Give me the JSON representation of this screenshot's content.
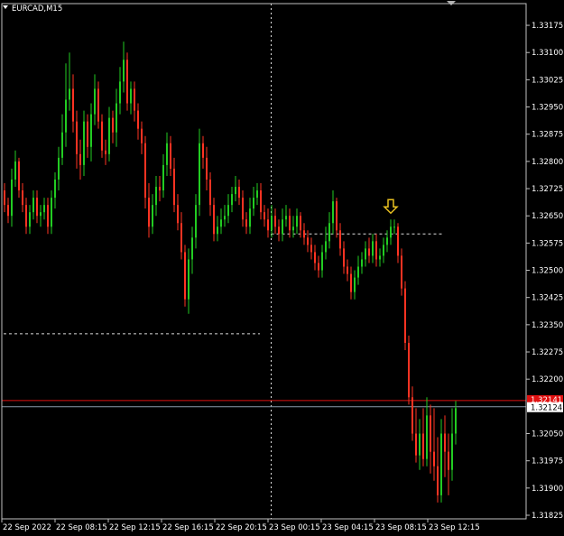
{
  "window": {
    "symbol_label": "EURCAD,M15"
  },
  "colors": {
    "background": "#000000",
    "frame": "#c0c0c0",
    "bull": "#22cc22",
    "bear": "#ff3322",
    "red_line": "#e01010",
    "ask_line": "#8a9aaa",
    "arrow": "#e8c020",
    "dashed": "#dddddd"
  },
  "markers": {
    "arrow_icon": "down-arrow-icon"
  },
  "chart_data": {
    "type": "candlestick",
    "symbol": "EURCAD",
    "timeframe": "M15",
    "ylim": [
      1.31825,
      1.332
    ],
    "y_ticks": [
      "1.33175",
      "1.33100",
      "1.33025",
      "1.32950",
      "1.32875",
      "1.32800",
      "1.32725",
      "1.32650",
      "1.32575",
      "1.32500",
      "1.32425",
      "1.32350",
      "1.32275",
      "1.32200",
      "1.32050",
      "1.31975",
      "1.31900",
      "1.31825"
    ],
    "x_ticks": [
      "22 Sep 2022",
      "22 Sep 08:15",
      "22 Sep 12:15",
      "22 Sep 16:15",
      "22 Sep 20:15",
      "23 Sep 00:15",
      "23 Sep 04:15",
      "23 Sep 08:15",
      "23 Sep 12:15"
    ],
    "price_labels": {
      "red": "1.32141",
      "current": "1.32124"
    },
    "levels": {
      "red_line": 1.32141,
      "current": 1.32124
    },
    "dashed_levels": [
      1.326,
      1.32325
    ],
    "crosshair_time_index": 74,
    "arrow_index": 107,
    "grid": false,
    "candles": {
      "o": [
        1.3272,
        1.3268,
        1.3265,
        1.3275,
        1.328,
        1.3272,
        1.3268,
        1.3262,
        1.3266,
        1.327,
        1.3265,
        1.3266,
        1.3268,
        1.3262,
        1.327,
        1.3275,
        1.3281,
        1.3288,
        1.3297,
        1.33,
        1.3291,
        1.3282,
        1.3279,
        1.3291,
        1.3284,
        1.3293,
        1.33,
        1.3291,
        1.3283,
        1.3282,
        1.3292,
        1.3288,
        1.3296,
        1.3302,
        1.3308,
        1.3296,
        1.33,
        1.3294,
        1.3289,
        1.3285,
        1.327,
        1.3262,
        1.3268,
        1.3273,
        1.3272,
        1.3279,
        1.3285,
        1.3278,
        1.3268,
        1.3263,
        1.3255,
        1.3242,
        1.3253,
        1.3259,
        1.3268,
        1.3285,
        1.3281,
        1.3275,
        1.3268,
        1.326,
        1.3262,
        1.3264,
        1.3265,
        1.3268,
        1.3271,
        1.3273,
        1.327,
        1.3264,
        1.3262,
        1.3267,
        1.327,
        1.3272,
        1.3266,
        1.3264,
        1.3261,
        1.3265,
        1.3262,
        1.326,
        1.3264,
        1.3265,
        1.3261,
        1.3262,
        1.3265,
        1.3261,
        1.3259,
        1.3257,
        1.3255,
        1.3252,
        1.325,
        1.3255,
        1.3258,
        1.3263,
        1.3269,
        1.3261,
        1.3256,
        1.3251,
        1.3249,
        1.3244,
        1.3248,
        1.3251,
        1.3253,
        1.3256,
        1.3254,
        1.3258,
        1.3253,
        1.3254,
        1.3257,
        1.3259,
        1.3262,
        1.3262,
        1.3254,
        1.3245,
        1.323,
        1.3215,
        1.3205,
        1.3199,
        1.3205,
        1.3198,
        1.321,
        1.32,
        1.3196,
        1.3188,
        1.3205,
        1.32,
        1.3195,
        1.3205
      ],
      "c": [
        1.3268,
        1.3265,
        1.3275,
        1.328,
        1.3272,
        1.3268,
        1.3262,
        1.3266,
        1.327,
        1.3265,
        1.3266,
        1.3268,
        1.3262,
        1.327,
        1.3275,
        1.3281,
        1.3288,
        1.3297,
        1.33,
        1.3291,
        1.3282,
        1.3279,
        1.3291,
        1.3284,
        1.3293,
        1.33,
        1.3291,
        1.3283,
        1.3282,
        1.3292,
        1.3288,
        1.3296,
        1.3302,
        1.3308,
        1.3296,
        1.33,
        1.3294,
        1.3289,
        1.3285,
        1.327,
        1.3262,
        1.3268,
        1.3273,
        1.3272,
        1.3279,
        1.3285,
        1.3278,
        1.3268,
        1.3263,
        1.3255,
        1.3242,
        1.3253,
        1.3259,
        1.3268,
        1.3285,
        1.3281,
        1.3275,
        1.3268,
        1.326,
        1.3262,
        1.3264,
        1.3265,
        1.3268,
        1.3271,
        1.3273,
        1.327,
        1.3264,
        1.3262,
        1.3267,
        1.327,
        1.3272,
        1.3266,
        1.3264,
        1.3261,
        1.3265,
        1.3262,
        1.326,
        1.3264,
        1.3265,
        1.3261,
        1.3262,
        1.3265,
        1.3261,
        1.3259,
        1.3257,
        1.3255,
        1.3252,
        1.325,
        1.3255,
        1.3258,
        1.3263,
        1.3269,
        1.3261,
        1.3256,
        1.3251,
        1.3249,
        1.3244,
        1.3248,
        1.3251,
        1.3253,
        1.3256,
        1.3254,
        1.3258,
        1.3253,
        1.3254,
        1.3257,
        1.3259,
        1.3262,
        1.3262,
        1.3254,
        1.3245,
        1.323,
        1.3215,
        1.3205,
        1.3199,
        1.3205,
        1.3198,
        1.321,
        1.32,
        1.3196,
        1.3188,
        1.3205,
        1.32,
        1.3195,
        1.3205,
        1.3212
      ],
      "h": [
        1.3274,
        1.327,
        1.3278,
        1.3283,
        1.3281,
        1.3274,
        1.327,
        1.3268,
        1.3272,
        1.3272,
        1.3268,
        1.327,
        1.327,
        1.3272,
        1.3277,
        1.3284,
        1.3293,
        1.3307,
        1.331,
        1.3304,
        1.3294,
        1.3286,
        1.3294,
        1.3293,
        1.3296,
        1.3304,
        1.3302,
        1.3293,
        1.3286,
        1.3295,
        1.3294,
        1.33,
        1.3306,
        1.3313,
        1.331,
        1.3302,
        1.3302,
        1.3296,
        1.3291,
        1.3287,
        1.3274,
        1.3271,
        1.3276,
        1.3276,
        1.3282,
        1.3288,
        1.3287,
        1.3281,
        1.3271,
        1.3266,
        1.3257,
        1.3256,
        1.3262,
        1.3271,
        1.3289,
        1.3287,
        1.3284,
        1.3277,
        1.327,
        1.3265,
        1.3267,
        1.3268,
        1.3271,
        1.3273,
        1.3276,
        1.3275,
        1.3272,
        1.3266,
        1.327,
        1.3273,
        1.3274,
        1.3274,
        1.3268,
        1.3267,
        1.3268,
        1.3267,
        1.3264,
        1.3267,
        1.3268,
        1.3267,
        1.3265,
        1.3267,
        1.3266,
        1.3263,
        1.3261,
        1.3259,
        1.3257,
        1.3254,
        1.3257,
        1.3262,
        1.3266,
        1.3272,
        1.327,
        1.3263,
        1.3258,
        1.3253,
        1.3251,
        1.325,
        1.3254,
        1.3255,
        1.3258,
        1.3259,
        1.326,
        1.326,
        1.3256,
        1.3259,
        1.3261,
        1.3264,
        1.3264,
        1.3263,
        1.3256,
        1.3247,
        1.3232,
        1.3218,
        1.3212,
        1.3209,
        1.3212,
        1.3215,
        1.3213,
        1.3212,
        1.3204,
        1.3209,
        1.321,
        1.3205,
        1.3212,
        1.3214
      ],
      "l": [
        1.3266,
        1.3263,
        1.3262,
        1.3273,
        1.327,
        1.3266,
        1.326,
        1.326,
        1.3264,
        1.3263,
        1.3262,
        1.3264,
        1.326,
        1.326,
        1.3267,
        1.3272,
        1.3279,
        1.3284,
        1.3294,
        1.3288,
        1.3278,
        1.3275,
        1.3276,
        1.3281,
        1.328,
        1.329,
        1.3289,
        1.3281,
        1.3279,
        1.328,
        1.3285,
        1.3284,
        1.3293,
        1.3299,
        1.3294,
        1.3293,
        1.3291,
        1.3286,
        1.3282,
        1.3267,
        1.3259,
        1.326,
        1.3265,
        1.3269,
        1.327,
        1.3276,
        1.3276,
        1.3266,
        1.3261,
        1.3253,
        1.324,
        1.3238,
        1.3249,
        1.3256,
        1.3265,
        1.3278,
        1.3272,
        1.3265,
        1.3258,
        1.3258,
        1.326,
        1.3262,
        1.3263,
        1.3266,
        1.3269,
        1.3268,
        1.3262,
        1.326,
        1.326,
        1.3265,
        1.3268,
        1.3264,
        1.3262,
        1.3259,
        1.3259,
        1.326,
        1.3258,
        1.3258,
        1.3262,
        1.3259,
        1.3259,
        1.326,
        1.3259,
        1.3257,
        1.3255,
        1.3253,
        1.325,
        1.3248,
        1.3248,
        1.3253,
        1.3256,
        1.326,
        1.3259,
        1.3254,
        1.3249,
        1.3247,
        1.3242,
        1.3242,
        1.3246,
        1.3249,
        1.3251,
        1.3252,
        1.3252,
        1.3251,
        1.3251,
        1.3252,
        1.3255,
        1.3257,
        1.326,
        1.3252,
        1.3243,
        1.3228,
        1.3213,
        1.3203,
        1.3197,
        1.3195,
        1.3196,
        1.3196,
        1.3194,
        1.3192,
        1.3186,
        1.3186,
        1.3193,
        1.3188,
        1.3192,
        1.3202
      ]
    }
  }
}
